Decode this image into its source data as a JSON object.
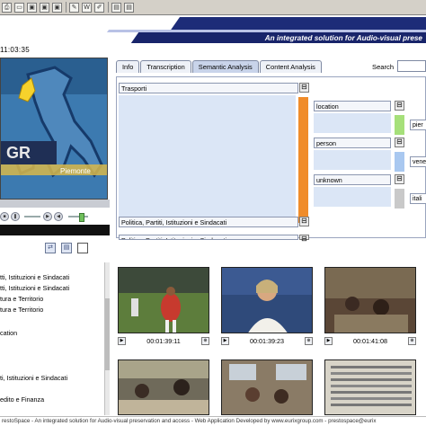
{
  "toolbar": {
    "buttons": [
      "print-icon",
      "folder-icon",
      "image-icon",
      "image-icon",
      "image-icon",
      "paint-icon",
      "word-icon",
      "edit-icon",
      "document-icon",
      "document-icon"
    ]
  },
  "banner": {
    "tagline": "An integrated solution for Audio-visual prese"
  },
  "video": {
    "timecode": "11:03:35",
    "overlay_text": "Piemonte",
    "logo_text": "GR"
  },
  "left_list": {
    "items": [
      "tti, Istituzioni e Sindacati",
      "tti, Istituzioni e Sindacati",
      "tura e Territorio",
      "tura e Territorio",
      "cation",
      "ti, Istituzioni e Sindacati",
      "edito e Finanza"
    ]
  },
  "tabs": [
    {
      "label": "Info",
      "active": false
    },
    {
      "label": "Transcription",
      "active": false
    },
    {
      "label": "Semantic Analysis",
      "active": true
    },
    {
      "label": "Content Analysis",
      "active": false
    }
  ],
  "search": {
    "label": "Search",
    "value": ""
  },
  "semantic": {
    "categories": [
      "Trasporti",
      "Politica, Partiti, Istituzioni e Sindacati",
      "Politica, Partiti, Istituzioni e Sindacati"
    ],
    "entities": [
      {
        "type": "location",
        "color": "#a6e07a",
        "value": "pier"
      },
      {
        "type": "person",
        "color": "#a9c8f0",
        "value": "vene"
      },
      {
        "type": "unknown",
        "color": "#c9c9c9",
        "value": "itali"
      }
    ],
    "button_glyph": "⊟"
  },
  "thumbnails": [
    {
      "time": "00:01:39:11"
    },
    {
      "time": "00:01:39:23"
    },
    {
      "time": "00:01:41:08"
    },
    {
      "time": ""
    },
    {
      "time": ""
    },
    {
      "time": ""
    }
  ],
  "footer": {
    "text": "restoSpace - An integrated solution for Audio-visual preservation and access - Web Application Developed by www.eurixgroup.com - prestospace@eurix"
  },
  "colors": {
    "banner_blue": "#1d2c78",
    "panel_blue": "#dbe6f6",
    "orange": "#f08c2a"
  }
}
